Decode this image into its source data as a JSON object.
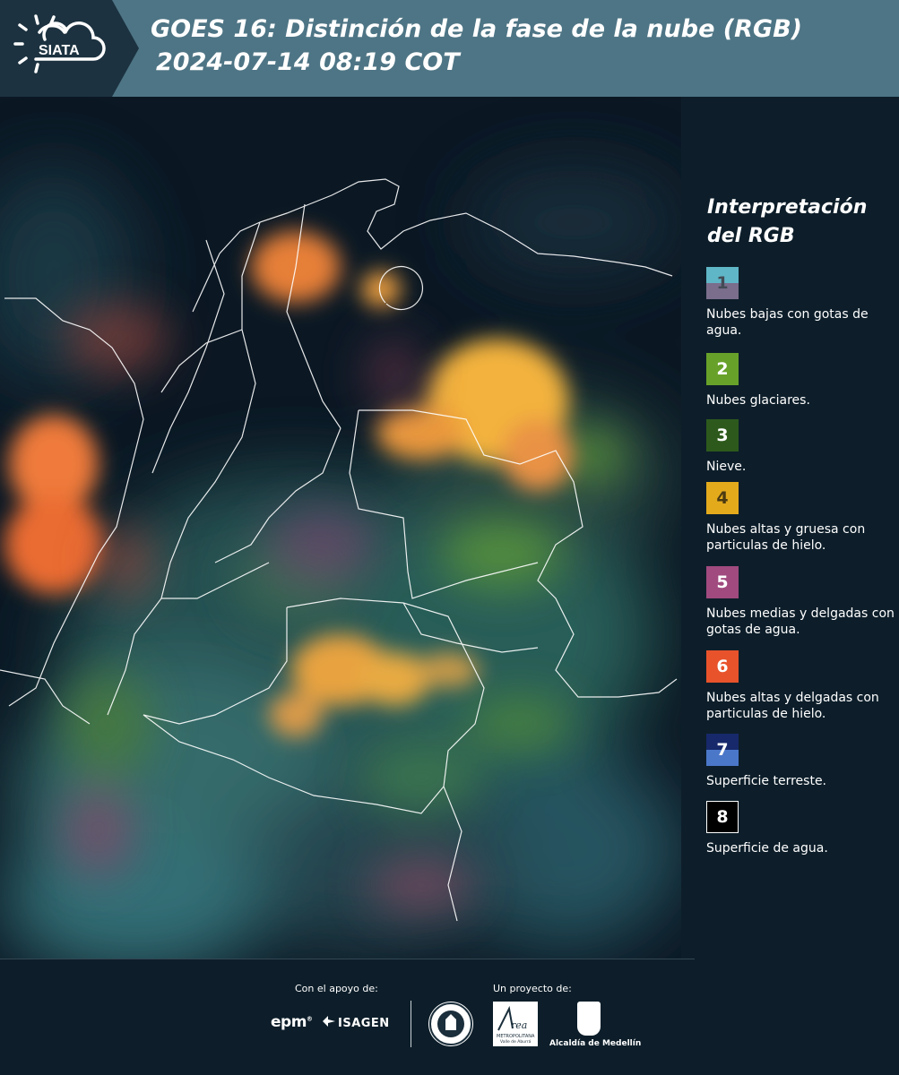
{
  "header": {
    "logo_text": "SIATA",
    "title_line1": "GOES 16: Distinción de la fase de la nube (RGB)",
    "title_line2": "2024-07-14 08:19 COT"
  },
  "legend": {
    "title": "Interpretación del RGB",
    "items": [
      {
        "number": "1",
        "label": "Nubes bajas con gotas de agua.",
        "color_top": "#5fb6c6",
        "color_bottom": "#7a6e8c",
        "number_color": "#434b55"
      },
      {
        "number": "2",
        "label": "Nubes glaciares.",
        "color": "#68a12a",
        "number_color": "#ffffff"
      },
      {
        "number": "3",
        "label": "Nieve.",
        "color": "#2d5a1c",
        "number_color": "#ffffff"
      },
      {
        "number": "4",
        "label": "Nubes altas y gruesa con particulas de hielo.",
        "color": "#e3aa1c",
        "number_color": "#4a3a12"
      },
      {
        "number": "5",
        "label": "Nubes medias y delgadas con gotas de agua.",
        "color": "#a04a7f",
        "number_color": "#ffffff"
      },
      {
        "number": "6",
        "label": "Nubes altas y delgadas con particulas de hielo.",
        "color": "#e8532b",
        "number_color": "#ffffff"
      },
      {
        "number": "7",
        "label": "Superficie terreste.",
        "color_top": "#17296a",
        "color_bottom": "#4b77c9",
        "number_color": "#ffffff"
      },
      {
        "number": "8",
        "label": "Superficie de agua.",
        "color": "#000000",
        "number_color": "#ffffff",
        "border": "#ffffff"
      }
    ]
  },
  "footer": {
    "support_label": "Con el apoyo de:",
    "project_label": "Un proyecto de:",
    "sponsors": [
      "epm",
      "ISAGEN"
    ],
    "partners": [
      "Área Metropolitana Valle de Aburrá",
      "Alcaldía de Medellín"
    ]
  }
}
